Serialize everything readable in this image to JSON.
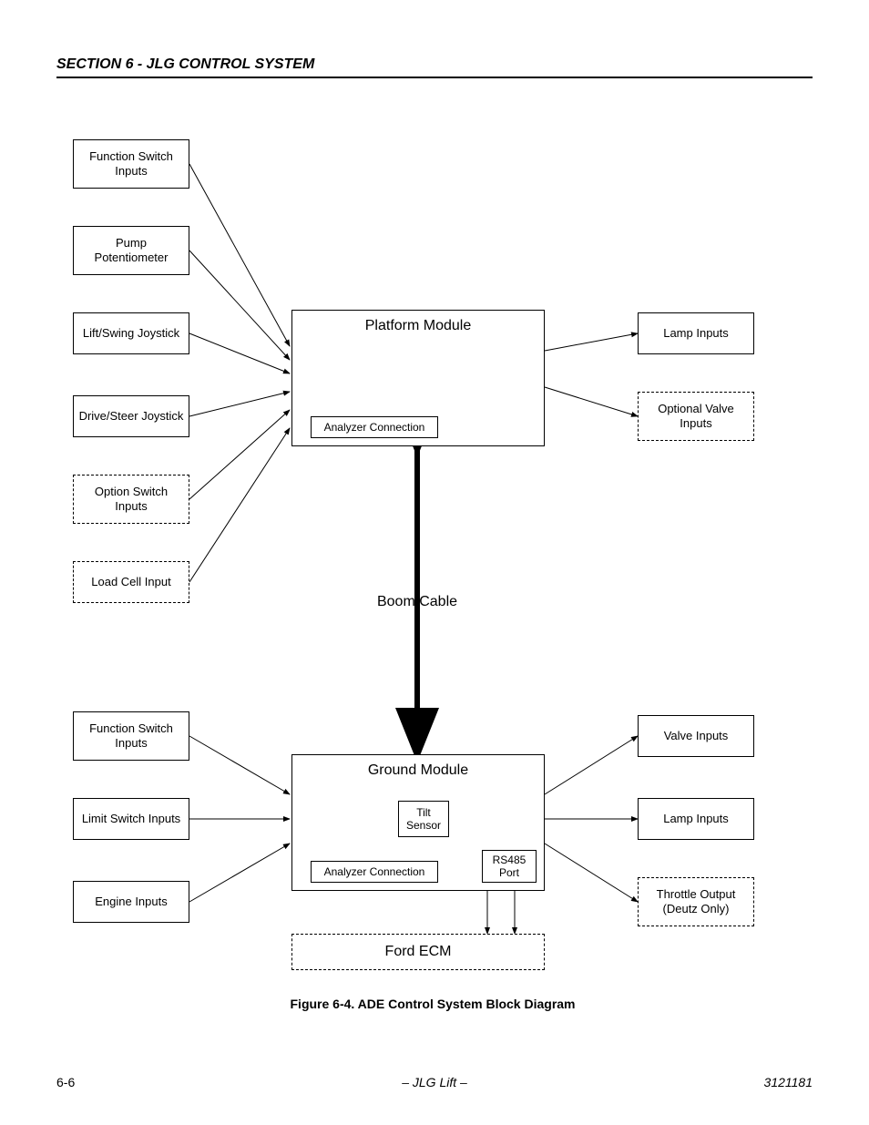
{
  "header": "SECTION 6 - JLG CONTROL SYSTEM",
  "caption": "Figure 6-4.  ADE Control System Block Diagram",
  "footer": {
    "left": "6-6",
    "center": "– JLG Lift –",
    "right": "3121181"
  },
  "boom_cable_label": "Boom Cable",
  "platform_module": {
    "title": "Platform Module",
    "left_inputs": [
      "Function Switch\nInputs",
      "Pump\nPotentiometer",
      "Lift/Swing Joystick",
      "Drive/Steer Joystick",
      "Option Switch\nInputs",
      "Load Cell Input"
    ],
    "left_dashed": [
      false,
      false,
      false,
      false,
      true,
      true
    ],
    "right_outputs": [
      "Lamp Inputs",
      "Optional Valve\nInputs"
    ],
    "right_dashed": [
      false,
      true
    ],
    "inner": [
      "Analyzer Connection"
    ]
  },
  "ground_module": {
    "title": "Ground Module",
    "left_inputs": [
      "Function Switch\nInputs",
      "Limit Switch Inputs",
      "Engine Inputs"
    ],
    "right_outputs": [
      "Valve Inputs",
      "Lamp Inputs",
      "Throttle Output\n(Deutz Only)"
    ],
    "right_dashed": [
      false,
      false,
      true
    ],
    "inner": [
      "Tilt\nSensor",
      "Analyzer Connection",
      "RS485\nPort"
    ],
    "bottom": "Ford ECM"
  }
}
